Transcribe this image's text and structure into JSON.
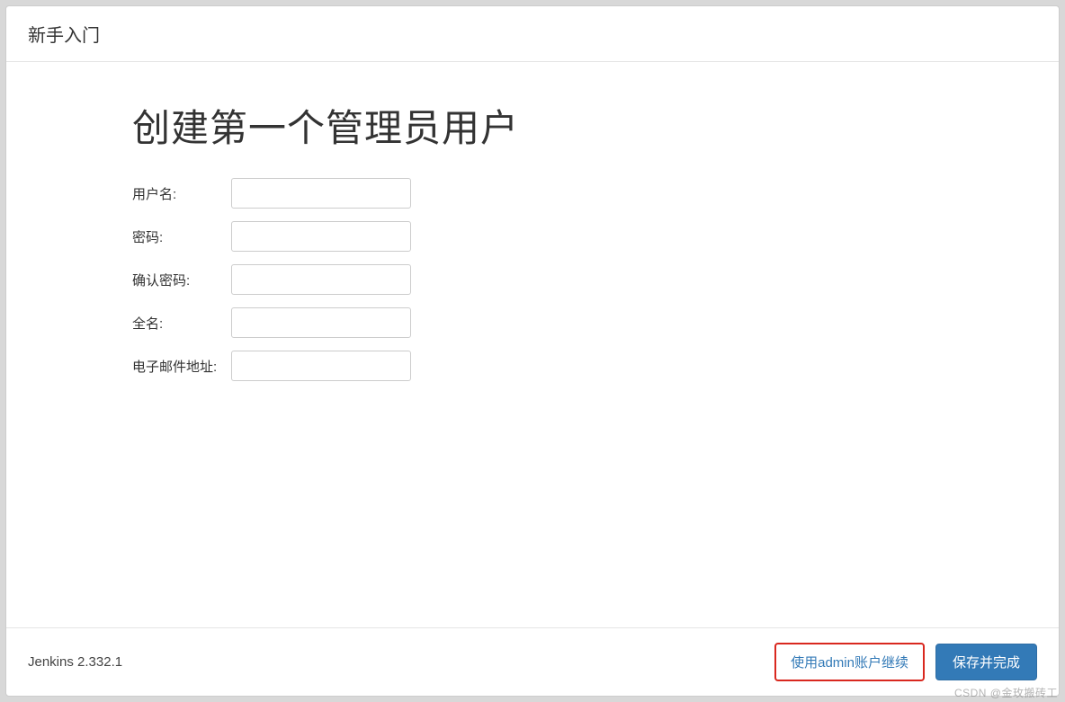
{
  "header": {
    "title": "新手入门"
  },
  "main": {
    "title": "创建第一个管理员用户",
    "fields": {
      "username": {
        "label": "用户名:",
        "value": ""
      },
      "password": {
        "label": "密码:",
        "value": ""
      },
      "confirm_password": {
        "label": "确认密码:",
        "value": ""
      },
      "fullname": {
        "label": "全名:",
        "value": ""
      },
      "email": {
        "label": "电子邮件地址:",
        "value": ""
      }
    }
  },
  "footer": {
    "version": "Jenkins 2.332.1",
    "skip_label": "使用admin账户继续",
    "save_label": "保存并完成"
  },
  "watermark": "CSDN @金玫搬砖工"
}
